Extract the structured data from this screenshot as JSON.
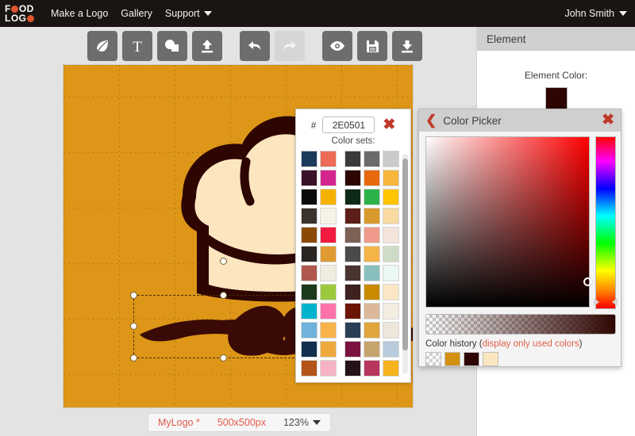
{
  "nav": {
    "brand": {
      "line1": "F",
      "line1b": "OD",
      "line2": "LOG",
      "name": "FOOD LOGO"
    },
    "links": [
      {
        "label": "Make a Logo",
        "has_caret": false
      },
      {
        "label": "Gallery",
        "has_caret": false
      },
      {
        "label": "Support",
        "has_caret": true
      }
    ],
    "user": {
      "label": "John Smith",
      "has_caret": true
    }
  },
  "toolbar": {
    "buttons": [
      {
        "icon": "leaf-icon",
        "name": "shape-leaf-tool",
        "label": "Leaf",
        "disabled": false
      },
      {
        "icon": "text-icon",
        "name": "text-tool",
        "label": "T",
        "disabled": false
      },
      {
        "icon": "shapes-icon",
        "name": "shapes-tool",
        "label": "Shapes",
        "disabled": false
      },
      {
        "icon": "upload-icon",
        "name": "upload-tool",
        "label": "Upload",
        "disabled": false
      },
      {
        "icon": "undo-icon",
        "name": "undo-button",
        "label": "Undo",
        "disabled": false
      },
      {
        "icon": "redo-icon",
        "name": "redo-button",
        "label": "Redo",
        "disabled": true
      },
      {
        "icon": "eye-icon",
        "name": "preview-button",
        "label": "Preview",
        "disabled": false
      },
      {
        "icon": "save-icon",
        "name": "save-button",
        "label": "Save",
        "disabled": false
      },
      {
        "icon": "download-icon",
        "name": "download-button",
        "label": "Download",
        "disabled": false
      }
    ]
  },
  "canvas": {
    "background_color": "#DD9617",
    "hat_fill": "#FCE6C0",
    "hat_outline": "#2E0501",
    "mustache_color": "#3A0A06",
    "selected_element": "mustache"
  },
  "statusbar": {
    "doc_name": "MyLogo *",
    "dimensions": "500x500px",
    "zoom": "123%"
  },
  "sidebar": {
    "title": "Element",
    "color_label": "Element Color:",
    "color_value": "#2E0501"
  },
  "swatch_panel": {
    "hash": "#",
    "hex_value": "2E0501",
    "close_label": "✖",
    "sets_label": "Color sets:",
    "columns_left": [
      [
        "#1B3B5C",
        "#3A1229",
        "#0A0A0A",
        "#3C322C",
        "#8A4A06",
        "#2A2522",
        "#B0584E",
        "#1E3A1C",
        "#00B3CC",
        "#6FB2DC",
        "#12304F",
        "#B55418",
        "#9E0F0F",
        "#4A1410"
      ],
      [
        "#EC6A56",
        "#D5268F",
        "#F7B200",
        "#F6F2E6",
        "#F01B3E",
        "#E09A32",
        "#EFECE0",
        "#9CC93B",
        "#FF72AC",
        "#F8B24A",
        "#EEA93C",
        "#F6B3C4",
        "#F8A72A",
        "#C69246"
      ]
    ],
    "columns_right": [
      [
        "#3A3A3A",
        "#2E0501",
        "#0E2A18",
        "#5C1F18",
        "#7C6157",
        "#4A4A4A",
        "#4A3430",
        "#3E2220",
        "#6B1604",
        "#2A3E56",
        "#7A1340",
        "#241217",
        "#1B2E4A"
      ],
      [
        "#6B6B6B",
        "#E8690B",
        "#2BB34A",
        "#D9982B",
        "#F09A8C",
        "#F5B447",
        "#8ABFBF",
        "#C98A00",
        "#DCB89A",
        "#E0A53C",
        "#C5A46E",
        "#B8355E",
        "#F79356"
      ],
      [
        "#CBCBCB",
        "#F6B73C",
        "#FFC400",
        "#F9DAA0",
        "#F4E4DB",
        "#CFDCC5",
        "#EAF7F5",
        "#FBE7C6",
        "#F4EDE2",
        "#EDE6DB",
        "#B8CBDC",
        "#F5B31E",
        "#F8E4E8"
      ]
    ]
  },
  "color_picker": {
    "title": "Color Picker",
    "back_label": "❮",
    "close_label": "✖",
    "hue_color": "#FF0000",
    "selected_color": "#2E0501",
    "history_label_plain": "Color history (",
    "history_label_accent": "display only used colors",
    "history_label_end": ")",
    "history": [
      {
        "name": "transparent",
        "color": "transparent"
      },
      {
        "name": "orange",
        "color": "#D4900F"
      },
      {
        "name": "dark-brown",
        "color": "#2E0501"
      },
      {
        "name": "cream",
        "color": "#FCE6C0"
      }
    ]
  }
}
